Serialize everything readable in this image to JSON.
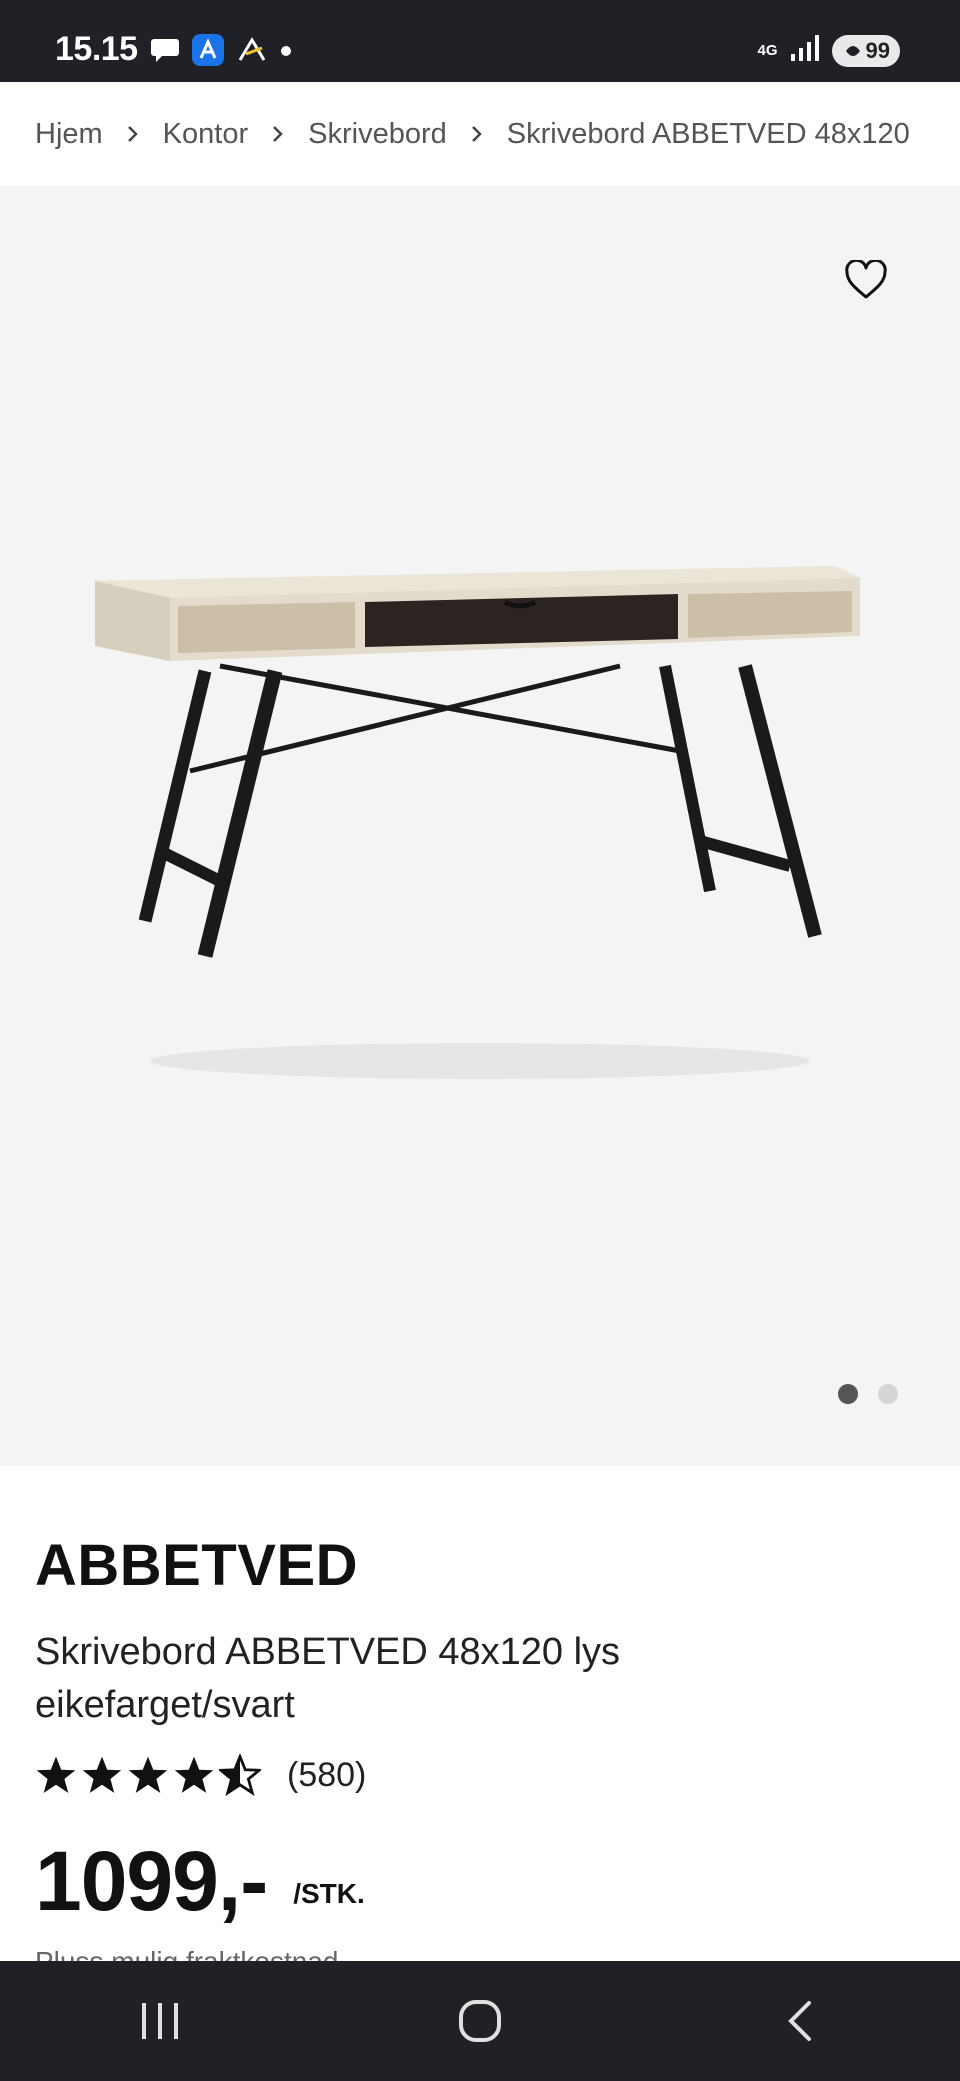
{
  "status_bar": {
    "time": "15.15",
    "network": "4G",
    "battery": "99",
    "icons": [
      "chat-bubble-icon",
      "app-a-icon",
      "app-a2-icon",
      "dot-icon",
      "signal-icon",
      "battery-icon"
    ]
  },
  "breadcrumb": {
    "items": [
      "Hjem",
      "Kontor",
      "Skrivebord",
      "Skrivebord ABBETVED 48x120"
    ]
  },
  "gallery": {
    "favorite_icon": "heart-icon",
    "image_count": 2,
    "active_index": 0
  },
  "product": {
    "brand": "ABBETVED",
    "description": "Skrivebord ABBETVED 48x120 lys eikefarget/svart",
    "rating": 4.5,
    "rating_count": "(580)",
    "price": "1099,-",
    "unit": "/STK.",
    "shipping_note": "Pluss mulig fraktkostnad"
  },
  "nav_bar": {
    "buttons": [
      "recent-apps-icon",
      "home-icon",
      "back-icon"
    ]
  },
  "colors": {
    "system_bar": "#1f2126",
    "gallery_bg": "#f4f4f4",
    "text": "#111111"
  }
}
